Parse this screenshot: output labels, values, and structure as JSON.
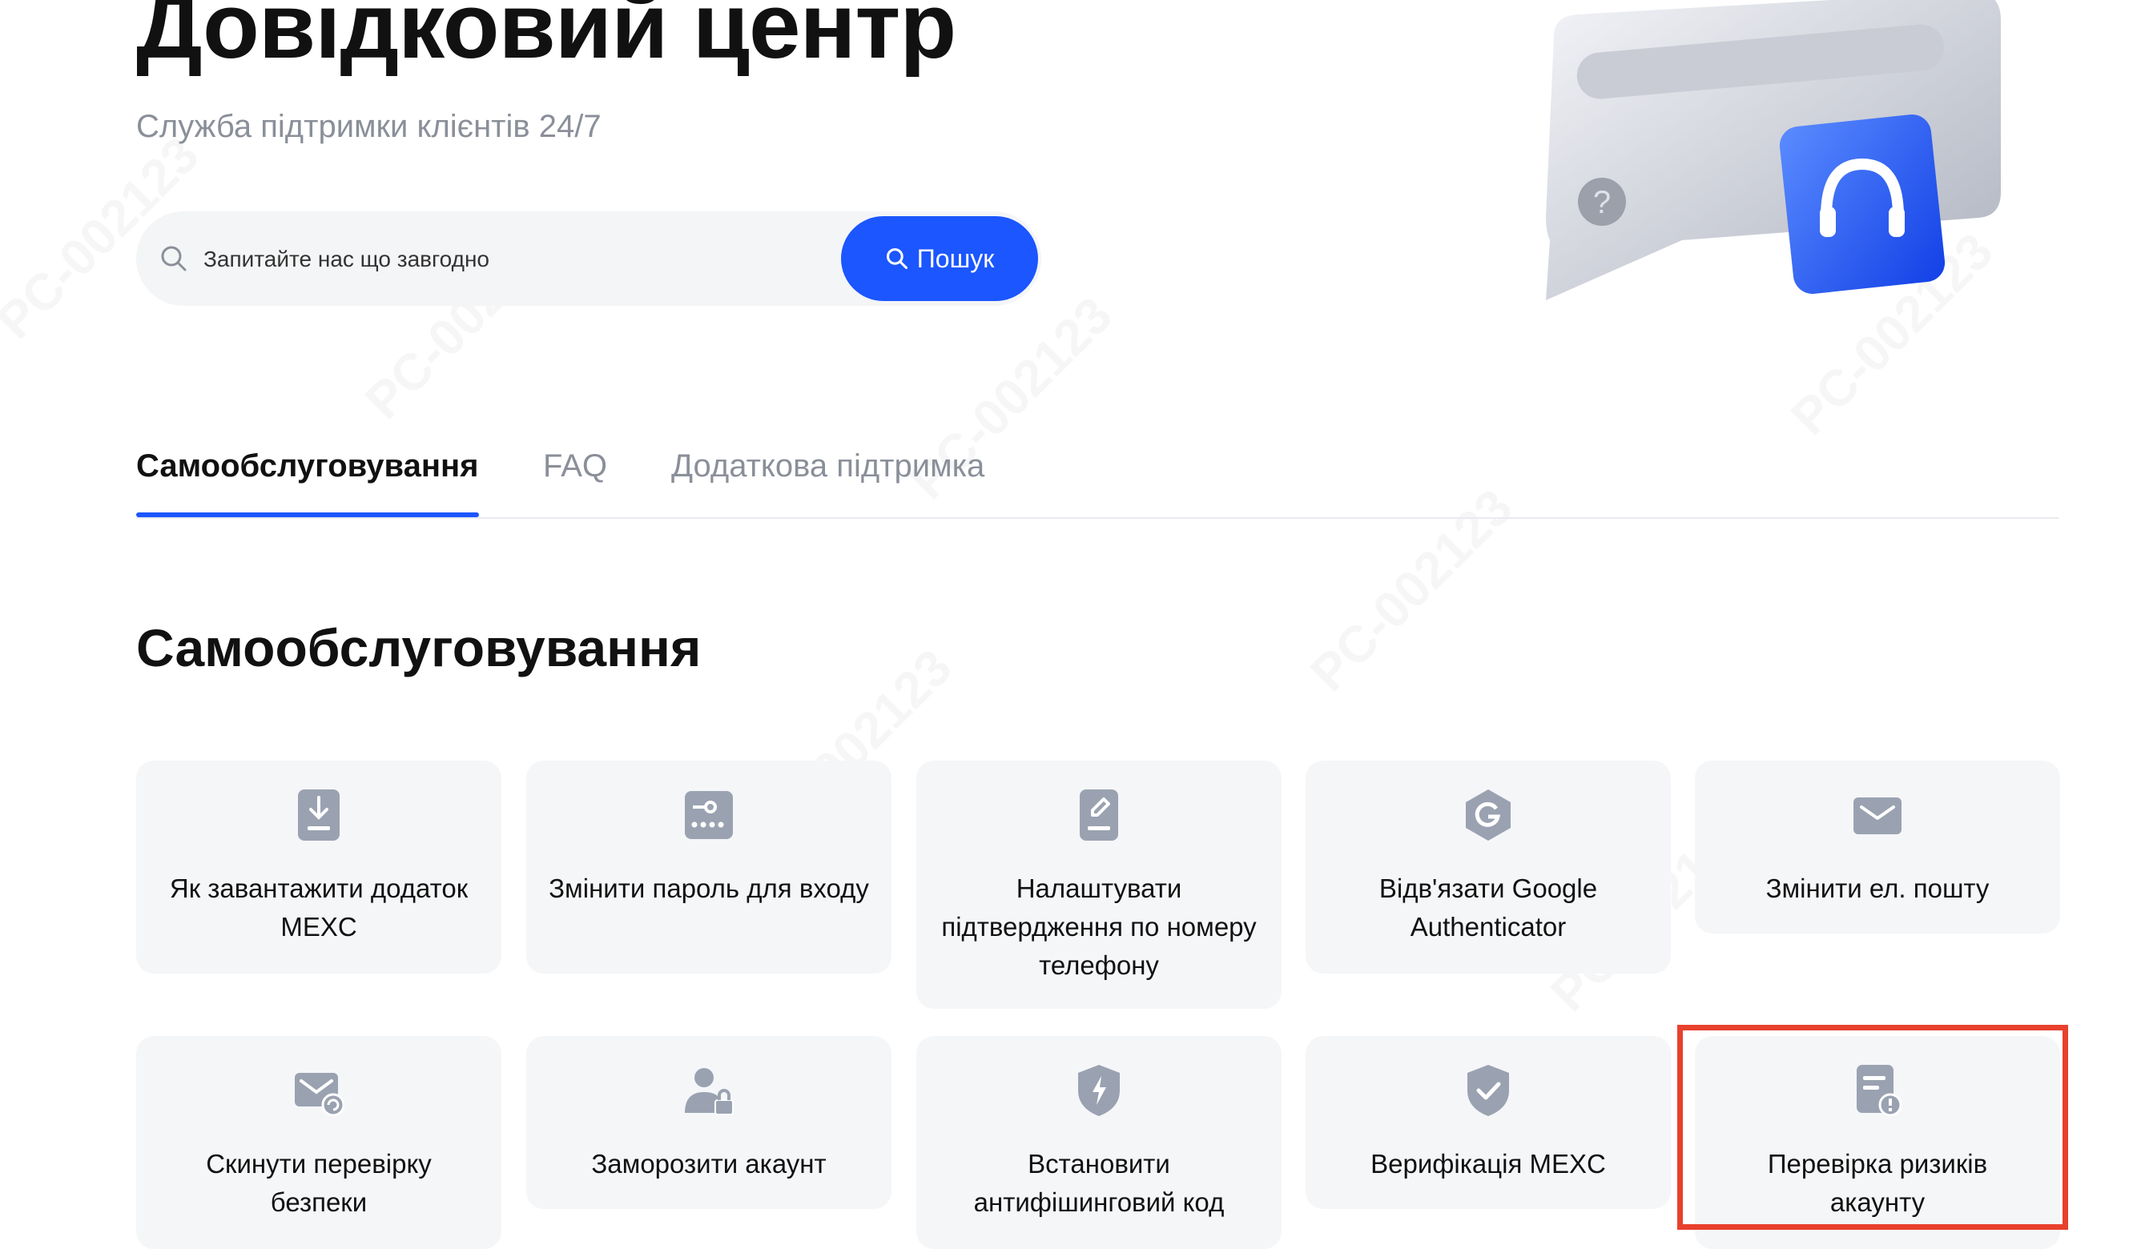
{
  "header": {
    "title": "Довідковий центр",
    "subtitle": "Служба підтримки клієнтів 24/7"
  },
  "search": {
    "placeholder": "Запитайте нас що завгодно",
    "button_label": "Пошук"
  },
  "tabs": [
    {
      "label": "Самообслуговування",
      "active": true
    },
    {
      "label": "FAQ",
      "active": false
    },
    {
      "label": "Додаткова підтримка",
      "active": false
    }
  ],
  "section": {
    "title": "Самообслуговування"
  },
  "cards": [
    {
      "label": "Як завантажити додаток MEXC",
      "icon": "download-app-icon"
    },
    {
      "label": "Змінити пароль для входу",
      "icon": "password-icon"
    },
    {
      "label": "Налаштувати підтвердження по номеру телефону",
      "icon": "phone-edit-icon"
    },
    {
      "label": "Відв'язати Google Authenticator",
      "icon": "google-authenticator-icon"
    },
    {
      "label": "Змінити ел. пошту",
      "icon": "email-icon"
    },
    {
      "label": "Скинути перевірку безпеки",
      "icon": "security-reset-icon"
    },
    {
      "label": "Заморозити акаунт",
      "icon": "freeze-account-icon"
    },
    {
      "label": "Встановити антифішинговий код",
      "icon": "antiphishing-shield-icon"
    },
    {
      "label": "Верифікація MEXC",
      "icon": "verification-shield-icon"
    },
    {
      "label": "Перевірка ризиків акаунту",
      "icon": "risk-check-icon"
    }
  ],
  "colors": {
    "accent": "#1b56ff",
    "card_bg": "#f5f6f8",
    "icon_gray": "#9aa2b1",
    "highlight": "#e8412d"
  }
}
